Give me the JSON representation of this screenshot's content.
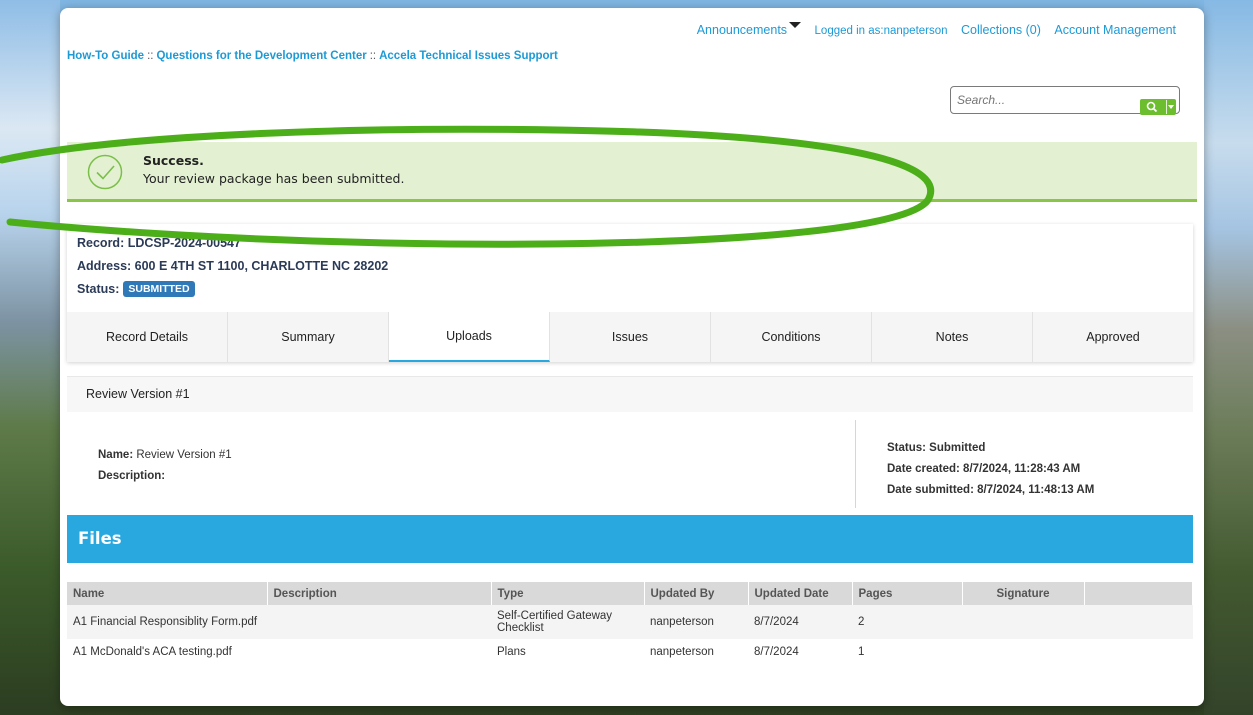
{
  "topnav": {
    "announcements": "Announcements",
    "logged_in": "Logged in as:nanpeterson",
    "collections": "Collections (0)",
    "account": "Account Management"
  },
  "quicklinks": [
    "How-To Guide",
    "Questions for the Development Center",
    "Accela Technical Issues Support"
  ],
  "search": {
    "placeholder": "Search..."
  },
  "success": {
    "title": "Success.",
    "message": "Your review package has been submitted."
  },
  "record": {
    "record_line": "Record: LDCSP-2024-00547",
    "address": "Address: 600 E 4TH ST 1100, CHARLOTTE NC 28202",
    "status_label": "Status:",
    "status": "SUBMITTED"
  },
  "tabs": [
    "Record Details",
    "Summary",
    "Uploads",
    "Issues",
    "Conditions",
    "Notes",
    "Approved"
  ],
  "active_tab": "Uploads",
  "review": {
    "header": "Review Version #1",
    "name_label": "Name:",
    "name": "Review Version #1",
    "description_label": "Description:",
    "status": "Status: Submitted",
    "date_created": "Date created: 8/7/2024, 11:28:43 AM",
    "date_submitted": "Date submitted: 8/7/2024, 11:48:13 AM"
  },
  "files": {
    "title": "Files",
    "columns": [
      "Name",
      "Description",
      "Type",
      "Updated By",
      "Updated Date",
      "Pages",
      "Signature"
    ],
    "rows": [
      [
        "A1 Financial Responsiblity Form.pdf",
        "",
        "Self-Certified Gateway Checklist",
        "nanpeterson",
        "8/7/2024",
        "2",
        ""
      ],
      [
        "A1 McDonald's ACA testing.pdf",
        "",
        "Plans",
        "nanpeterson",
        "8/7/2024",
        "1",
        ""
      ]
    ]
  },
  "colors": {
    "accent": "#29a8e0",
    "success_bg": "#e3f1d2",
    "highlight": "#4caf1a",
    "badge": "#2f79b9"
  }
}
